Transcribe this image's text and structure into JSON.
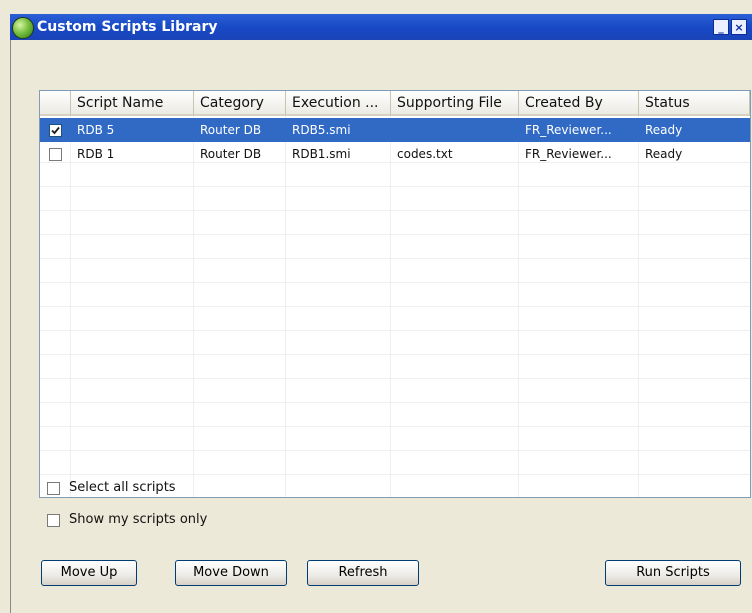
{
  "window": {
    "title": "Custom Scripts Library",
    "controls": [
      "_",
      "×"
    ]
  },
  "table": {
    "columns": [
      "",
      "Script Name",
      "Category",
      "Execution ...",
      "Supporting File",
      "Created By",
      "Status"
    ],
    "rows": [
      {
        "checked": true,
        "selected": true,
        "cells": [
          "RDB 5",
          "Router DB",
          "RDB5.smi",
          "",
          "FR_Reviewer...",
          "Ready"
        ]
      },
      {
        "checked": false,
        "selected": false,
        "cells": [
          "RDB 1",
          "Router DB",
          "RDB1.smi",
          "codes.txt",
          "FR_Reviewer...",
          "Ready"
        ]
      }
    ]
  },
  "options": {
    "select_all": "Select all scripts",
    "show_mine": "Show my scripts only"
  },
  "buttons": {
    "move_up": "Move Up",
    "move_down": "Move Down",
    "refresh": "Refresh",
    "run": "Run Scripts"
  },
  "colors": {
    "titlebar": "#2a5fd6",
    "selection": "#316ac5",
    "window_bg": "#ece9d8"
  }
}
